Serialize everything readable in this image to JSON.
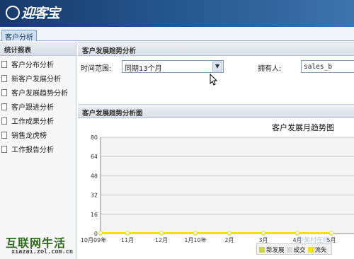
{
  "app": {
    "logo_text": "迎客宝"
  },
  "tabs": [
    {
      "label": "客户分析"
    }
  ],
  "sidebar": {
    "title": "统计报表",
    "items": [
      {
        "label": "客户分布分析"
      },
      {
        "label": "新客户发展分析"
      },
      {
        "label": "客户发展趋势分析"
      },
      {
        "label": "客户跟进分析"
      },
      {
        "label": "工作成果分析"
      },
      {
        "label": "销售龙虎榜"
      },
      {
        "label": "工作报告分析"
      }
    ]
  },
  "filter_panel": {
    "title": "客户发展趋势分析",
    "range_label": "时间范围:",
    "range_value": "同期13个月",
    "owner_label": "拥有人:",
    "owner_value": "sales_b"
  },
  "chart_panel": {
    "title": "客户发展趋势分析图"
  },
  "chart_data": {
    "type": "line",
    "title": "客户发展月趋势图",
    "categories": [
      "10月09年",
      "11月",
      "12月",
      "1月10年",
      "2月",
      "3月",
      "4月",
      "5月"
    ],
    "y_ticks": [
      0,
      16,
      32,
      48,
      64,
      80
    ],
    "ylim": [
      0,
      80
    ],
    "grid": true,
    "series": [
      {
        "name": "新发展",
        "color": "#c8d63c",
        "values": [
          0,
          0,
          0,
          0,
          0,
          0,
          0,
          0
        ]
      },
      {
        "name": "成交",
        "color": "#d9d9d9",
        "values": [
          0,
          0,
          0,
          0,
          0,
          0,
          0,
          0
        ]
      },
      {
        "name": "流失",
        "color": "#f2e400",
        "values": [
          0,
          0,
          0,
          0,
          0,
          0,
          0,
          0
        ]
      }
    ]
  },
  "watermark": {
    "brand": "互联网牛活",
    "url": "xiazai.zol.com.cn",
    "corner": "中关村在线"
  }
}
